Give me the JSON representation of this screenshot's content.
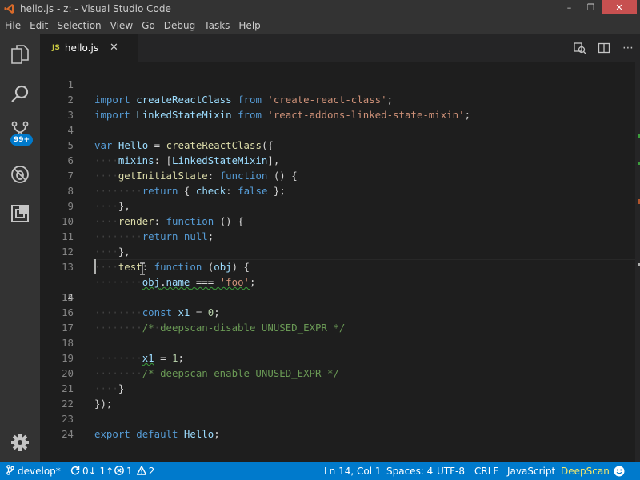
{
  "window": {
    "title": "hello.js - z: - Visual Studio Code",
    "minimize": "–",
    "maximize": "❐",
    "close": "✕"
  },
  "menu": [
    "File",
    "Edit",
    "Selection",
    "View",
    "Go",
    "Debug",
    "Tasks",
    "Help"
  ],
  "activity_bar": {
    "icons": [
      "files-icon",
      "search-icon",
      "source-control-icon",
      "debug-icon",
      "extensions-icon",
      "settings-gear-icon"
    ],
    "scm_badge": "99+"
  },
  "tab": {
    "file_type": "JS",
    "label": "hello.js",
    "close": "✕"
  },
  "editor": {
    "cursor": {
      "line": 14,
      "column": 1
    },
    "lines": [
      {
        "n": "1"
      },
      {
        "n": "2"
      },
      {
        "n": "3"
      },
      {
        "n": "4"
      },
      {
        "n": "5"
      },
      {
        "n": "6"
      },
      {
        "n": "7"
      },
      {
        "n": "8"
      },
      {
        "n": "9"
      },
      {
        "n": "10"
      },
      {
        "n": "11"
      },
      {
        "n": "12"
      },
      {
        "n": "13"
      },
      {
        "n": "14"
      },
      {
        "n": "15"
      },
      {
        "n": "16"
      },
      {
        "n": "17"
      },
      {
        "n": "18"
      },
      {
        "n": "19"
      },
      {
        "n": "20"
      },
      {
        "n": "21"
      },
      {
        "n": "22"
      },
      {
        "n": "23"
      },
      {
        "n": "24"
      }
    ],
    "tokens": {
      "l1": [
        "import",
        "createReactClass",
        "from",
        "'create-react-class'",
        ";"
      ],
      "l2": [
        "import",
        "LinkedStateMixin",
        "from",
        "'react-addons-linked-state-mixin'",
        ";"
      ],
      "l4": [
        "var",
        "Hello",
        "=",
        "createReactClass",
        "({"
      ],
      "l5": [
        "mixins",
        ": [",
        "LinkedStateMixin",
        "],"
      ],
      "l6": [
        "getInitialState",
        ":",
        "function",
        "() {"
      ],
      "l7": [
        "return",
        "{",
        "check",
        ":",
        "false",
        "};"
      ],
      "l8": [
        "},"
      ],
      "l9": [
        "render",
        ":",
        "function",
        "() {"
      ],
      "l10": [
        "return",
        "null",
        ";"
      ],
      "l11": [
        "},"
      ],
      "l12": [
        "test",
        ":",
        "function",
        "(",
        "obj",
        ") {"
      ],
      "l13": [
        "obj",
        ".",
        "name",
        "===",
        "'foo'",
        ";"
      ],
      "l15": [
        "const",
        "x1",
        "=",
        "0",
        ";"
      ],
      "l16": [
        "/* deepscan-disable UNUSED_EXPR */"
      ],
      "l18": [
        "x1",
        "=",
        "1",
        ";"
      ],
      "l19": [
        "/* deepscan-enable UNUSED_EXPR */"
      ],
      "l20": [
        "}"
      ],
      "l21": [
        "});"
      ],
      "l23": [
        "export",
        "default",
        "Hello",
        ";"
      ]
    }
  },
  "status_bar": {
    "branch": "develop*",
    "sync": "0↓ 1↑",
    "errors": "1",
    "warnings": "2",
    "position": "Ln 14, Col 1",
    "spaces": "Spaces: 4",
    "encoding": "UTF-8",
    "eol": "CRLF",
    "language": "JavaScript",
    "deepscan": "DeepScan",
    "feedback_icon": "smiley-icon"
  },
  "colors": {
    "accent": "#007acc",
    "keyword": "#569cd6",
    "string": "#ce9178",
    "comment": "#6a9955",
    "variable": "#9cdcfe",
    "function": "#dcdcaa",
    "number": "#b5cea8"
  }
}
